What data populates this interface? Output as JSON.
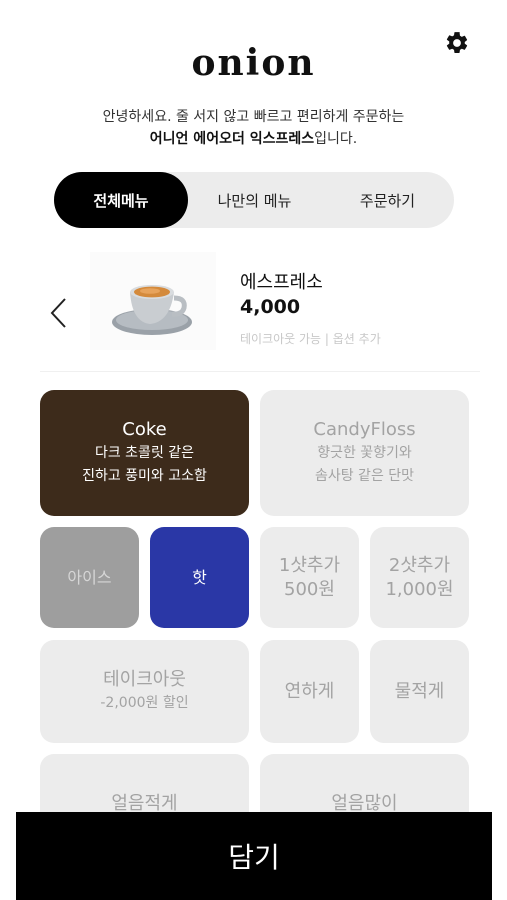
{
  "header": {
    "logo": "onion",
    "greeting_line1": "안녕하세요. 줄 서지 않고 빠르고 편리하게 주문하는",
    "greeting_bold": "어니언 에어오더 익스프레스",
    "greeting_tail": "입니다."
  },
  "tabs": [
    {
      "label": "전체메뉴",
      "active": true
    },
    {
      "label": "나만의 메뉴",
      "active": false
    },
    {
      "label": "주문하기",
      "active": false
    }
  ],
  "product": {
    "name": "에스프레소",
    "price": "4,000",
    "meta": "테이크아웃 가능 | 옵션 추가"
  },
  "options": {
    "bean_coke": {
      "title": "Coke",
      "line1": "다크 초콜릿 같은",
      "line2": "진하고 풍미와 고소함"
    },
    "bean_candy": {
      "title": "CandyFloss",
      "line1": "향긋한 꽃향기와",
      "line2": "솜사탕 같은 단맛"
    },
    "ice": "아이스",
    "hot": "핫",
    "shot1": {
      "title": "1샷추가",
      "price": "500원"
    },
    "shot2": {
      "title": "2샷추가",
      "price": "1,000원"
    },
    "takeout": {
      "title": "테이크아웃",
      "sub": "-2,000원 할인"
    },
    "mild": "연하게",
    "watery": "물적게",
    "less_ice": "얼음적게",
    "more_ice": "얼음많이"
  },
  "footer": {
    "add_button": "담기"
  },
  "colors": {
    "selected_bean": "#3d2b1b",
    "selected_temp": "#2a37a6",
    "ice_selected_gray": "#9e9e9e",
    "card_bg": "#ececec"
  }
}
